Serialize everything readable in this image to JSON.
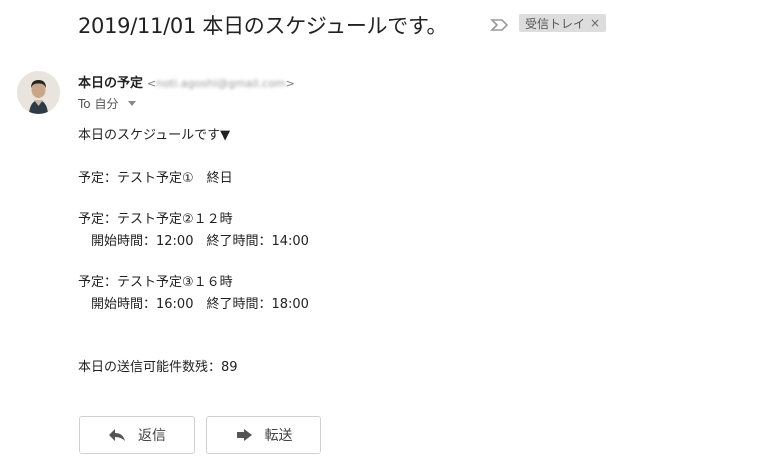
{
  "header": {
    "subject": "2019/11/01 本日のスケジュールです。",
    "label": "受信トレイ",
    "label_remove": "×"
  },
  "sender": {
    "name": "本日の予定",
    "email_open": "<",
    "email_obscured": "noti.agoshi@gmail.com",
    "email_close": ">",
    "to": "To 自分"
  },
  "body": {
    "lines": [
      "本日のスケジュールです▼",
      "予定：テスト予定①　終日",
      "予定：テスト予定②１２時",
      "　開始時間：12:00　終了時間：14:00",
      "予定：テスト予定③１６時",
      "　開始時間：16:00　終了時間：18:00",
      "本日の送信可能件数残：89"
    ]
  },
  "actions": {
    "reply_label": "返信",
    "forward_label": "転送"
  },
  "icons": [
    "importance-marker-icon",
    "chevron-down-icon",
    "reply-arrow-icon",
    "forward-arrow-icon",
    "avatar-photo"
  ]
}
